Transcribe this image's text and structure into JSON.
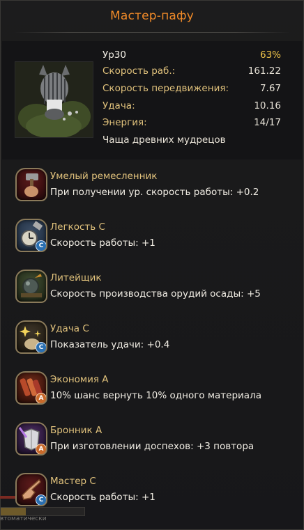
{
  "window": {
    "title": "Мастер-пафу"
  },
  "worker": {
    "level": "Ур30",
    "experience_percent": "63%",
    "stats": [
      {
        "label": "Скорость раб.:",
        "value": "161.22"
      },
      {
        "label": "Скорость передвижения:",
        "value": "7.67"
      },
      {
        "label": "Удача:",
        "value": "10.16"
      },
      {
        "label": "Энергия:",
        "value": "14/17"
      }
    ],
    "location": "Чаща древних мудрецов"
  },
  "skills": [
    {
      "name": "Умелый ремесленник",
      "desc": "При получении ур. скорость работы: +0.2",
      "icon": "hammer-fist-icon",
      "grade": ""
    },
    {
      "name": "Легкость C",
      "desc": "Скорость работы: +1",
      "icon": "clock-hammer-icon",
      "grade": "C"
    },
    {
      "name": "Литейщик",
      "desc": "Скорость производства орудий осады: +5",
      "icon": "cannonball-icon",
      "grade": ""
    },
    {
      "name": "Удача C",
      "desc": "Показатель удачи: +0.4",
      "icon": "sparkle-luck-icon",
      "grade": "C"
    },
    {
      "name": "Экономия A",
      "desc": "10% шанс вернуть 10% одного материала",
      "icon": "materials-icon",
      "grade": "A"
    },
    {
      "name": "Бронник A",
      "desc": "При изготовлении доспехов: +3 повтора",
      "icon": "armor-icon",
      "grade": "A"
    },
    {
      "name": "Мастер C",
      "desc": "Скорость работы: +1",
      "icon": "pointing-hand-icon",
      "grade": "C"
    }
  ],
  "background": {
    "fragment_text": "втоматически",
    "bar_fill": 0.3
  },
  "colors": {
    "title": "#f08a28",
    "skill_name": "#e1c27c",
    "percent": "#f2c64a",
    "grade_c": "#2a6fb0",
    "grade_a": "#c8692a"
  }
}
